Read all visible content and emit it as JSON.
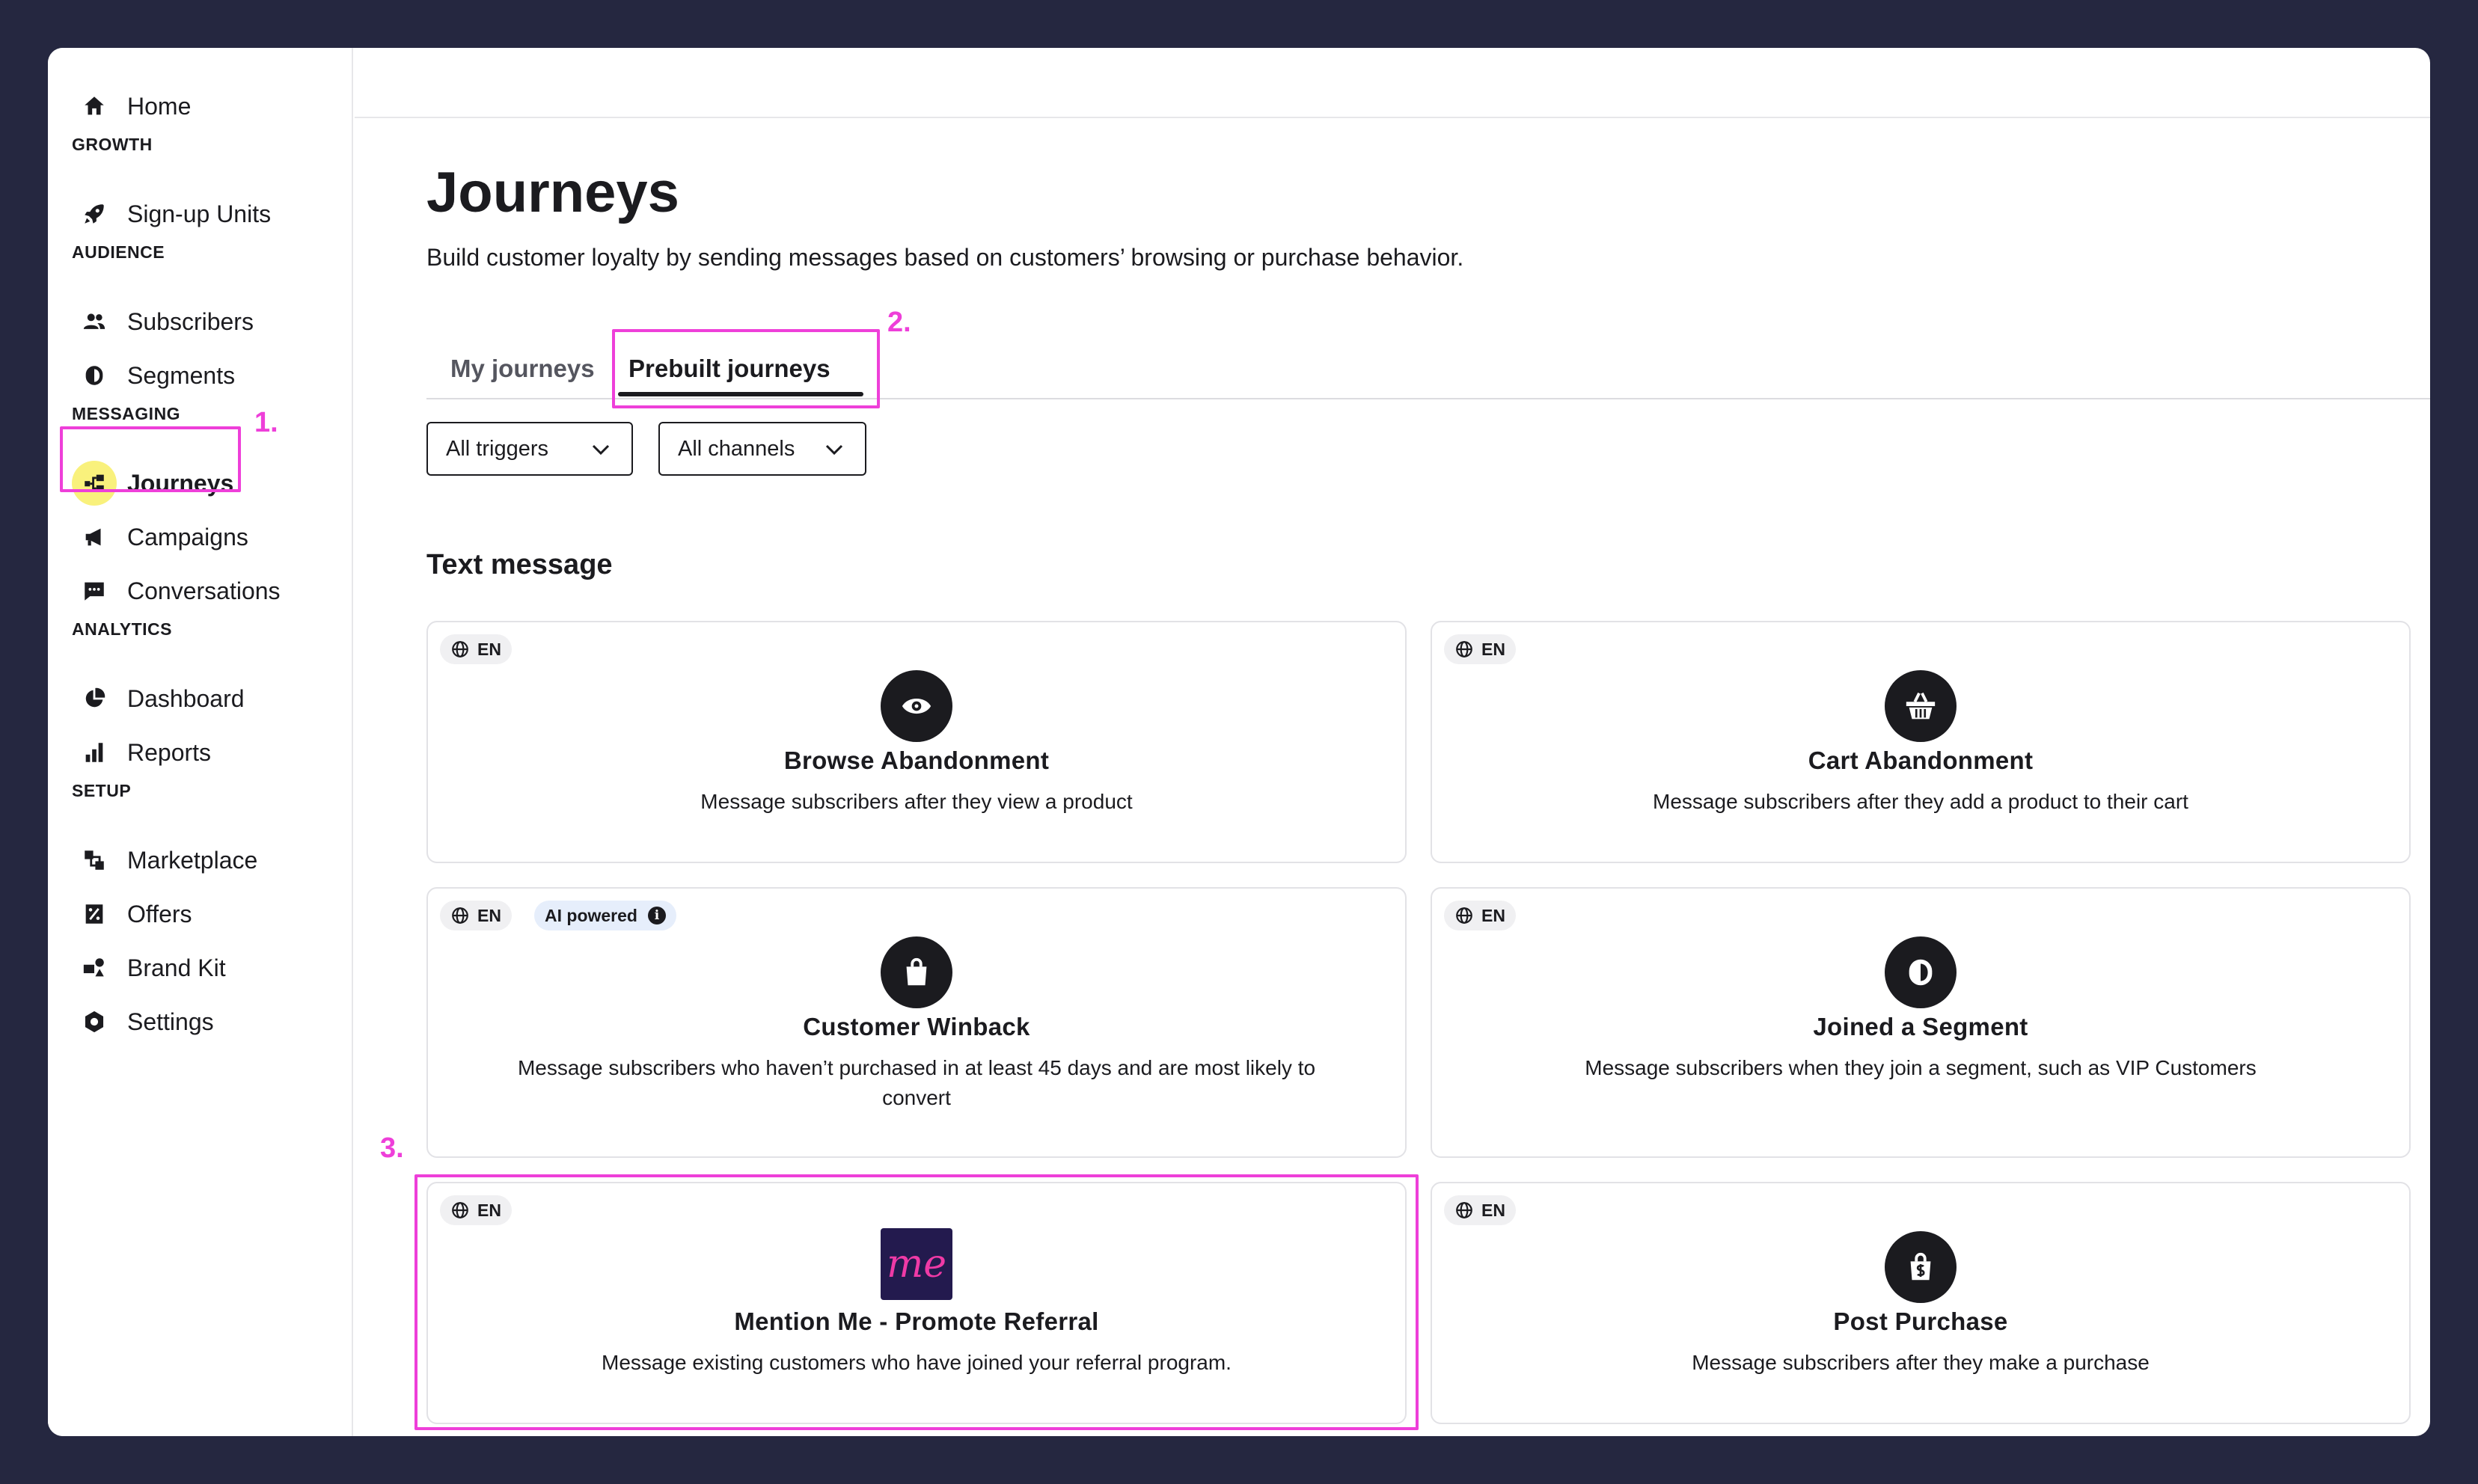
{
  "sidebar": {
    "home": "Home",
    "sections": {
      "growth": "GROWTH",
      "audience": "AUDIENCE",
      "messaging": "MESSAGING",
      "analytics": "ANALYTICS",
      "setup": "SETUP"
    },
    "items": {
      "signup_units": "Sign-up Units",
      "subscribers": "Subscribers",
      "segments": "Segments",
      "journeys": "Journeys",
      "campaigns": "Campaigns",
      "conversations": "Conversations",
      "dashboard": "Dashboard",
      "reports": "Reports",
      "marketplace": "Marketplace",
      "offers": "Offers",
      "brand_kit": "Brand Kit",
      "settings": "Settings"
    },
    "active_item": "journeys",
    "active_highlight_color": "#f9f17c"
  },
  "main": {
    "title": "Journeys",
    "subtitle": "Build customer loyalty by sending messages based on customers’ browsing or purchase behavior.",
    "tabs": [
      {
        "label": "My journeys",
        "active": false
      },
      {
        "label": "Prebuilt journeys",
        "active": true
      }
    ],
    "filters": {
      "triggers": "All triggers",
      "channels": "All channels"
    },
    "section_title": "Text message",
    "language_badge": "EN",
    "ai_badge": "AI powered",
    "ai_info_glyph": "i",
    "cards": [
      {
        "title": "Browse Abandonment",
        "description": "Message subscribers after they view a product",
        "icon": "eye-icon"
      },
      {
        "title": "Cart Abandonment",
        "description": "Message subscribers after they add a product to their cart",
        "icon": "basket-icon"
      },
      {
        "title": "Customer Winback",
        "description": "Message subscribers who haven’t purchased in at least 45 days and are most likely to convert",
        "icon": "shopping-bag-icon",
        "ai_powered": true
      },
      {
        "title": "Joined a Segment",
        "description": "Message subscribers when they join a segment, such as VIP Customers",
        "icon": "segment-icon"
      },
      {
        "title": "Mention Me - Promote Referral",
        "description": "Message existing customers who have joined your referral program.",
        "icon": "mention-me-logo",
        "logo_text": "me"
      },
      {
        "title": "Post Purchase",
        "description": "Message subscribers after they make a purchase",
        "icon": "dollar-bag-icon"
      }
    ]
  },
  "annotations": {
    "color": "#ee3fd9",
    "step1": "1.",
    "step2": "2.",
    "step3": "3."
  }
}
